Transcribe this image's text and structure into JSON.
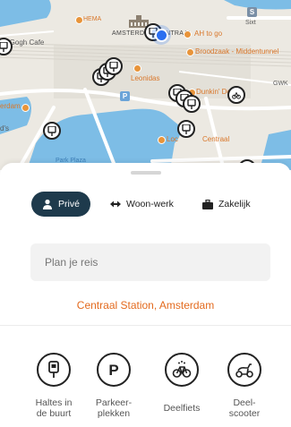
{
  "map": {
    "labels": {
      "hema": "HEMA",
      "amsterdam_centraal": "AMSTERDAM CENTRAAL",
      "ah_to_go": "AH to go",
      "sixt": "Sixt",
      "van_gogh_cafe": "n Gogh Cafe",
      "broodzaak": "Broodzaak - Middentunnel",
      "leonidas": "Leonidas",
      "dunkin": "Dunkin' Donuts",
      "gwk": "GWK",
      "erdam": "erdam",
      "ds": "d's",
      "loco": "Loc",
      "loco_centraal": "Centraal",
      "park_plaza": "Park Plaza"
    },
    "colors": {
      "water": "#7dbde6",
      "land": "#ece9e2",
      "road": "#ffffff",
      "poi": "#e8943a",
      "location": "#2a6ef0"
    }
  },
  "sheet": {
    "segments": [
      {
        "label": "Privé",
        "icon": "person-icon",
        "active": true
      },
      {
        "label": "Woon-werk",
        "icon": "arrows-icon",
        "active": false
      },
      {
        "label": "Zakelijk",
        "icon": "briefcase-icon",
        "active": false
      }
    ],
    "search": {
      "placeholder": "Plan je reis"
    },
    "station": "Centraal Station, Amsterdam",
    "tiles": [
      {
        "label": "Haltes in\nde buurt",
        "icon": "bus-stop-icon"
      },
      {
        "label": "Parkeer-\nplekken",
        "icon": "parking-icon"
      },
      {
        "label": "Deelfiets",
        "icon": "bike-share-icon"
      },
      {
        "label": "Deel-\nscooter",
        "icon": "scooter-icon"
      }
    ],
    "accent": "#1e3a4c",
    "station_color": "#e36a1e"
  }
}
